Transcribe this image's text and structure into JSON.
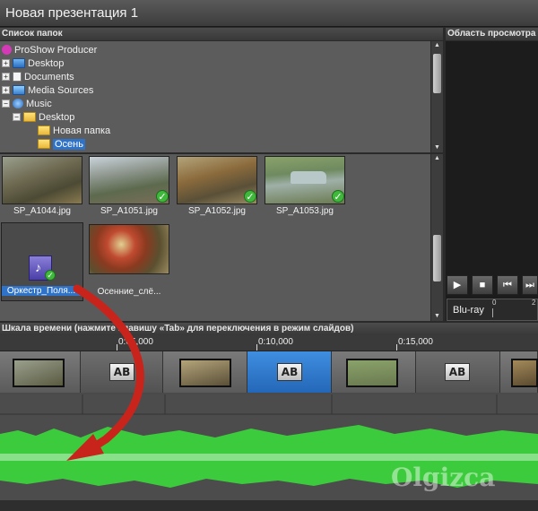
{
  "window": {
    "title": "Новая презентация 1"
  },
  "folders_panel": {
    "title": "Список папок"
  },
  "preview_panel": {
    "title": "Область просмотра",
    "output_format": "Blu-ray",
    "ruler_left": "0",
    "ruler_right": "2"
  },
  "tree": [
    {
      "label": "ProShow Producer",
      "icon": "proshow-icon",
      "exp": ""
    },
    {
      "label": "Desktop",
      "icon": "desktop-icon",
      "exp": "+"
    },
    {
      "label": "Documents",
      "icon": "documents-icon",
      "exp": "+"
    },
    {
      "label": "Media Sources",
      "icon": "media-sources-icon",
      "exp": "+"
    },
    {
      "label": "Music",
      "icon": "music-icon",
      "exp": "−"
    },
    {
      "label": "Desktop",
      "icon": "folder-icon",
      "exp": "−"
    },
    {
      "label": "Новая папка",
      "icon": "folder-icon",
      "exp": ""
    },
    {
      "label": "Осень",
      "icon": "folder-icon",
      "exp": ""
    }
  ],
  "files": [
    {
      "name": "SP_A1044.jpg",
      "checked": false
    },
    {
      "name": "SP_A1051.jpg",
      "checked": true
    },
    {
      "name": "SP_A1052.jpg",
      "checked": true
    },
    {
      "name": "SP_A1053.jpg",
      "checked": true
    },
    {
      "name": "Оркестр_Поля...",
      "checked": true
    },
    {
      "name": "Осенние_слё...",
      "checked": false
    }
  ],
  "timeline": {
    "title": "Шкала времени (нажмите клавишу «Tab» для переключения в режим слайдов)",
    "ticks": [
      "0:05,000",
      "0:10,000",
      "0:15,000"
    ],
    "transition_label": "AB"
  },
  "watermark": "Olgizca",
  "colors": {
    "selection": "#2f73c9",
    "waveform": "#3ccb3c",
    "arrow": "#c8241c",
    "check": "#3fb83c"
  }
}
